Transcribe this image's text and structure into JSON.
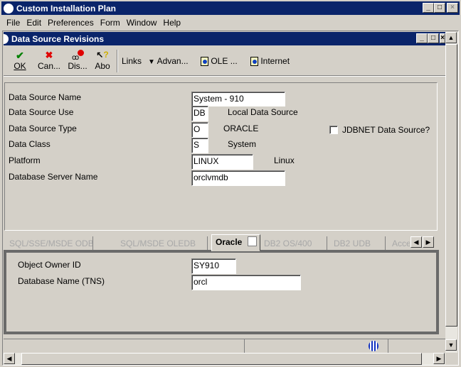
{
  "app": {
    "title": "Custom Installation Plan"
  },
  "menu": [
    "File",
    "Edit",
    "Preferences",
    "Form",
    "Window",
    "Help"
  ],
  "form": {
    "title": "Data Source Revisions"
  },
  "toolbar": {
    "ok": "OK",
    "cancel": "Can...",
    "display": "Dis...",
    "about": "Abo",
    "links": "Links",
    "advanced": "Advan...",
    "ole": "OLE ...",
    "internet": "Internet"
  },
  "fields": {
    "name": {
      "label": "Data Source Name",
      "value": "System - 910"
    },
    "use": {
      "label": "Data Source Use",
      "value": "DB",
      "desc": "Local Data Source"
    },
    "type": {
      "label": "Data Source Type",
      "value": "O",
      "desc": "ORACLE"
    },
    "class": {
      "label": "Data Class",
      "value": "S",
      "desc": "System"
    },
    "platform": {
      "label": "Platform",
      "value": "LINUX",
      "desc": "Linux"
    },
    "server": {
      "label": "Database Server Name",
      "value": "orclvmdb"
    },
    "jdbnet": {
      "label": "JDBNET Data Source?",
      "checked": false
    }
  },
  "tabs": [
    "SQL/SSE/MSDE ODBC",
    "SQL/MSDE OLEDB",
    "Oracle",
    "DB2 OS/400",
    "DB2 UDB",
    "Acce"
  ],
  "oracle": {
    "owner": {
      "label": "Object Owner ID",
      "value": "SY910"
    },
    "tns": {
      "label": "Database Name (TNS)",
      "value": "orcl"
    }
  }
}
